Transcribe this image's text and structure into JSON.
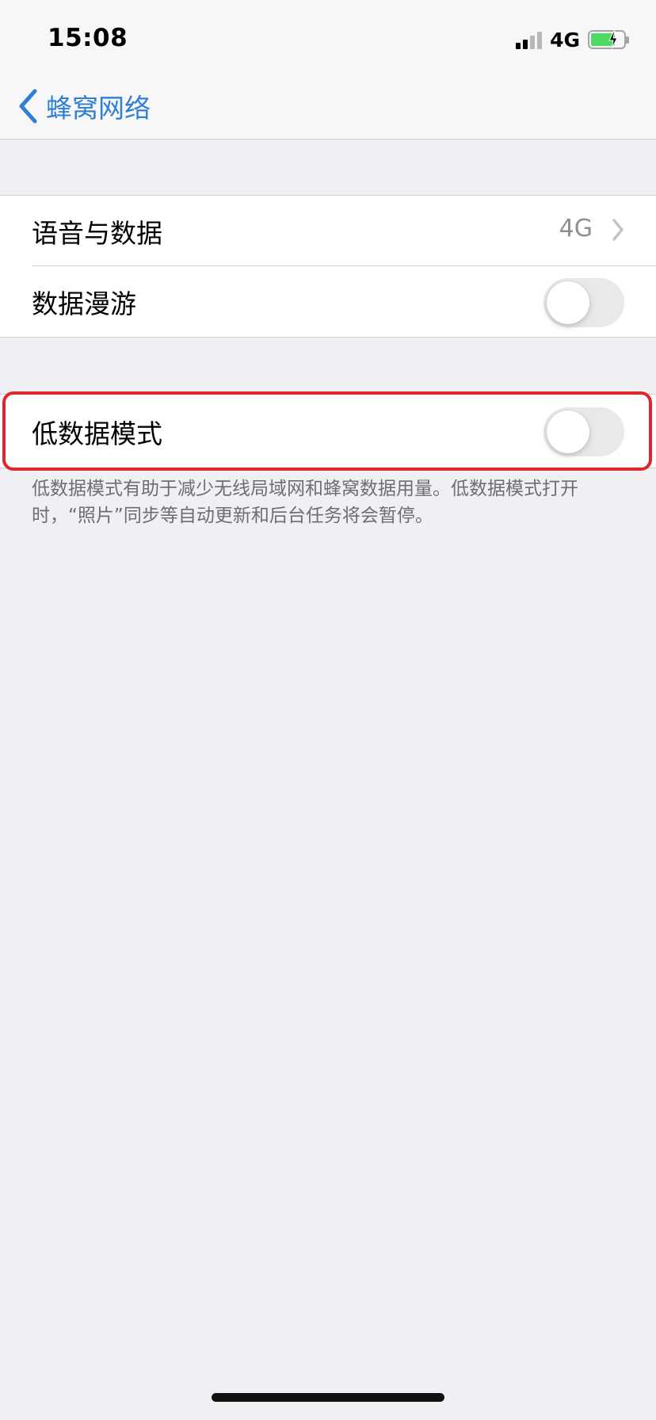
{
  "status_bar": {
    "time": "15:08",
    "network": "4G",
    "signal_bars_filled": 2,
    "signal_bars_total": 4,
    "battery_charging": true
  },
  "nav": {
    "back_label": "蜂窝网络"
  },
  "group_1": {
    "voice_data": {
      "label": "语音与数据",
      "value": "4G"
    },
    "data_roaming": {
      "label": "数据漫游",
      "enabled": false
    }
  },
  "group_2": {
    "low_data_mode": {
      "label": "低数据模式",
      "enabled": false
    }
  },
  "footnote": "低数据模式有助于减少无线局域网和蜂窝数据用量。低数据模式打开时，“照片”同步等自动更新和后台任务将会暂停。",
  "colors": {
    "accent": "#2f7fd6",
    "highlight": "#e0262b",
    "background": "#efeff4"
  }
}
